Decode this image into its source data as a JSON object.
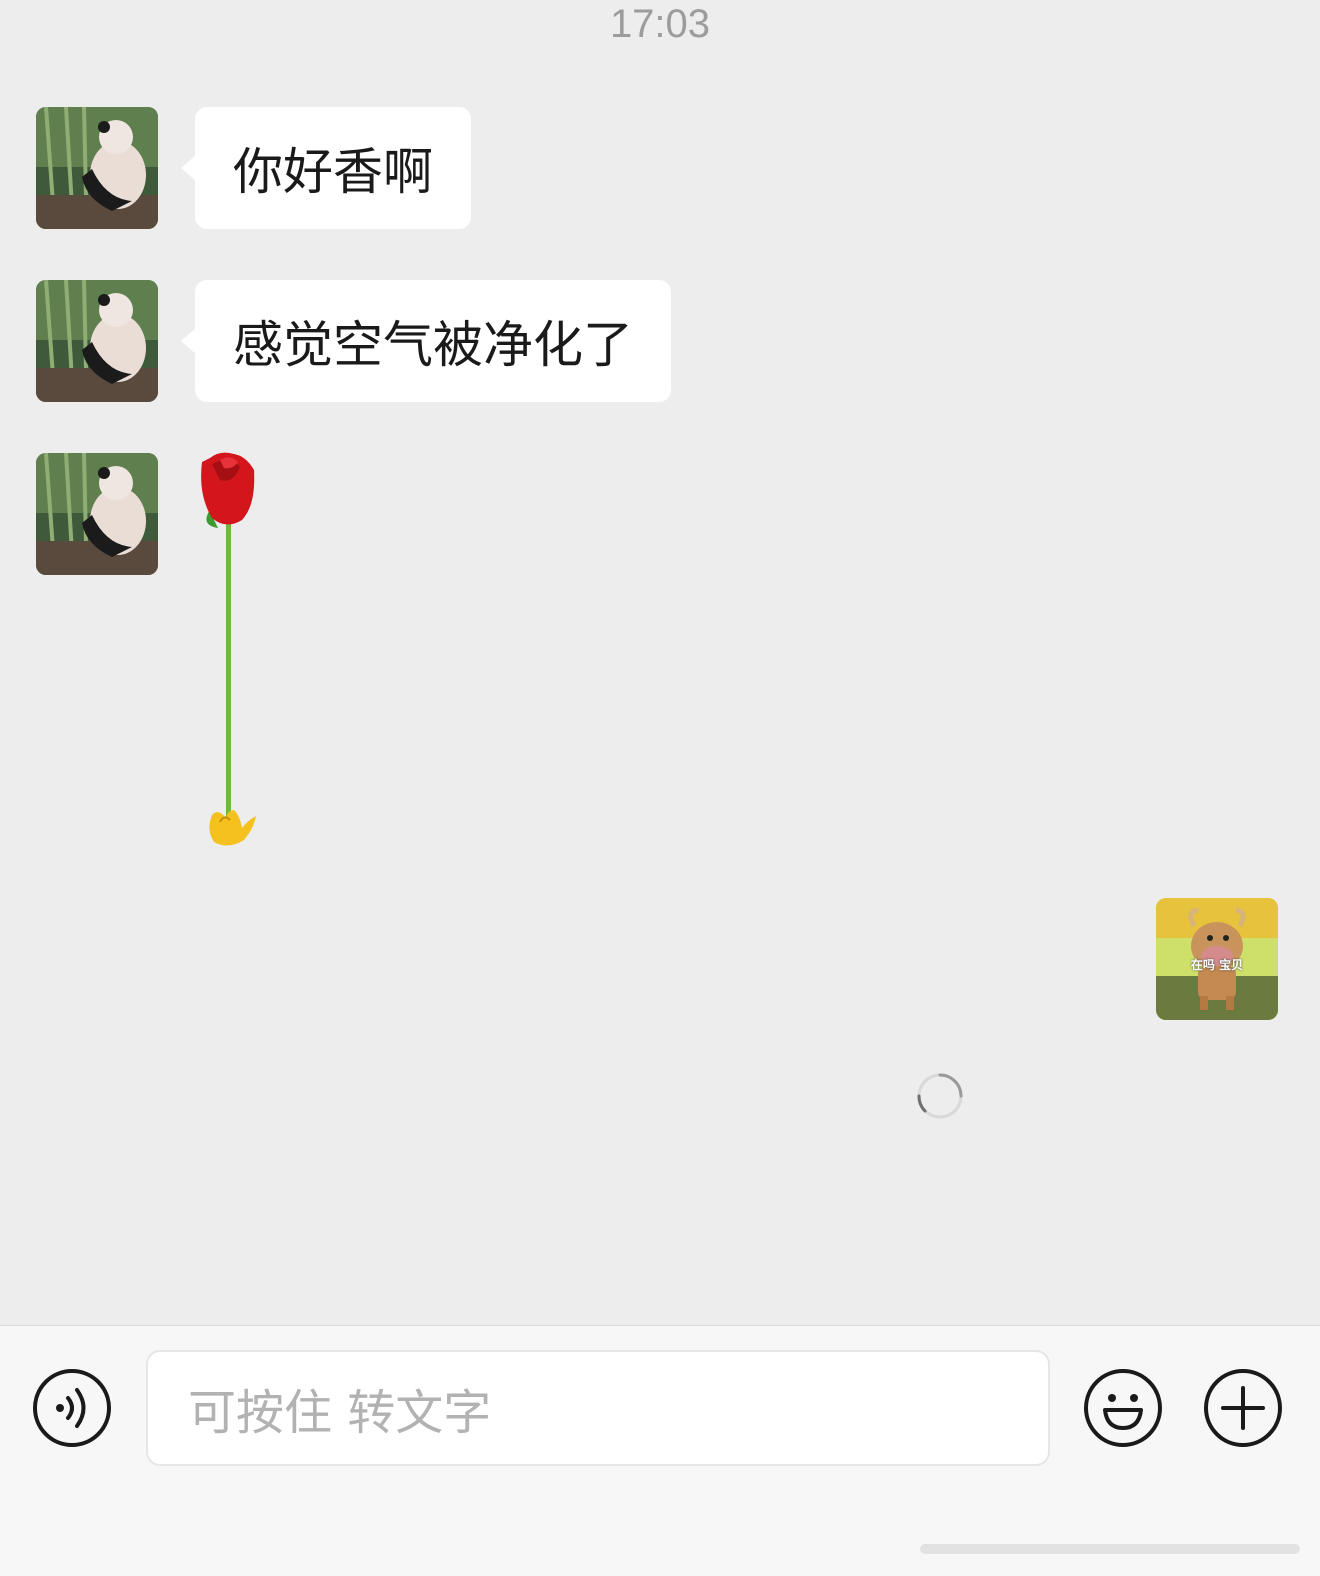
{
  "chat": {
    "timestamp": "17:03",
    "messages": [
      {
        "sender": "contact",
        "type": "text",
        "text": "你好香啊"
      },
      {
        "sender": "contact",
        "type": "text",
        "text": "感觉空气被净化了"
      },
      {
        "sender": "contact",
        "type": "sticker",
        "sticker": "rose-in-hand"
      },
      {
        "sender": "me",
        "type": "sticker-avatar",
        "caption": "在吗 宝贝"
      }
    ]
  },
  "input_bar": {
    "placeholder": "可按住 转文字",
    "icons": [
      "voice-icon",
      "emoji-icon",
      "plus-icon"
    ]
  },
  "colors": {
    "chat_background": "#ededed",
    "bubble": "#ffffff",
    "input_bar_background": "#f7f7f7"
  }
}
